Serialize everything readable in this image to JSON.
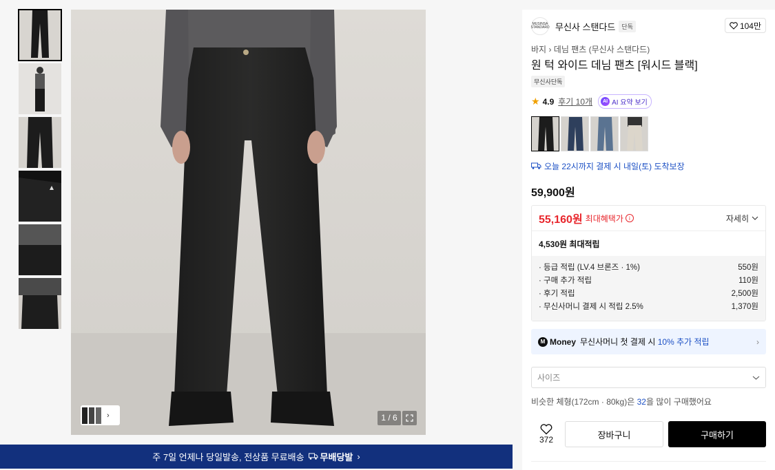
{
  "gallery": {
    "counter": "1 / 6",
    "thumb_count": 6
  },
  "banner": {
    "text": "주 7일 언제나 당일발송, 전상품 무료배송",
    "tag": "무배당발",
    "chev": "›"
  },
  "brand": {
    "logo_text": "MUSINSA STANDARD",
    "name": "무신사 스탠다드",
    "badge": "단독",
    "likes": "104만"
  },
  "breadcrumb": {
    "category": "바지",
    "sep": "›",
    "sub": "데님 팬츠 (무신사 스탠다드)"
  },
  "product": {
    "title": "원 턱 와이드 데님 팬츠 [워시드 블랙]",
    "exclusive_tag": "무신사단독",
    "rating": "4.9",
    "reviews": "후기 10개",
    "ai_label": "AI 요약 보기",
    "ai_icon": "AI",
    "delivery": "오늘 22시까지 결제 시 내일(토) 도착보장",
    "price": "59,900원"
  },
  "colors": {
    "options": [
      "#1c1c1c",
      "#2e3f5c",
      "#5a7391",
      "#dcd6cb"
    ]
  },
  "benefit": {
    "sale_price": "55,160원",
    "max_label": "최대혜택가",
    "detail_label": "자세히",
    "points_label": "4,530원 최대적립",
    "rows": [
      {
        "label": "· 등급 적립 (LV.4 브론즈 · 1%)",
        "value": "550원"
      },
      {
        "label": "· 구매 추가 적립",
        "value": "110원"
      },
      {
        "label": "· 후기 적립",
        "value": "2,500원"
      },
      {
        "label": "· 무신사머니 결제 시 적립 2.5%",
        "value": "1,370원"
      }
    ]
  },
  "money": {
    "logo": "M",
    "name": "Money",
    "text_pre": "무신사머니 첫 결제 시",
    "text_hl": "10% 추가 적립",
    "chev": "›"
  },
  "size": {
    "placeholder": "사이즈",
    "chev": "⌄"
  },
  "similar": {
    "pre": "비슷한 체형(172cm · 80kg)은",
    "num": "32",
    "post": "을 많이 구매했어요"
  },
  "actions": {
    "heart_icon": "♡",
    "like_count": "372",
    "cart": "장바구니",
    "buy": "구매하기"
  }
}
